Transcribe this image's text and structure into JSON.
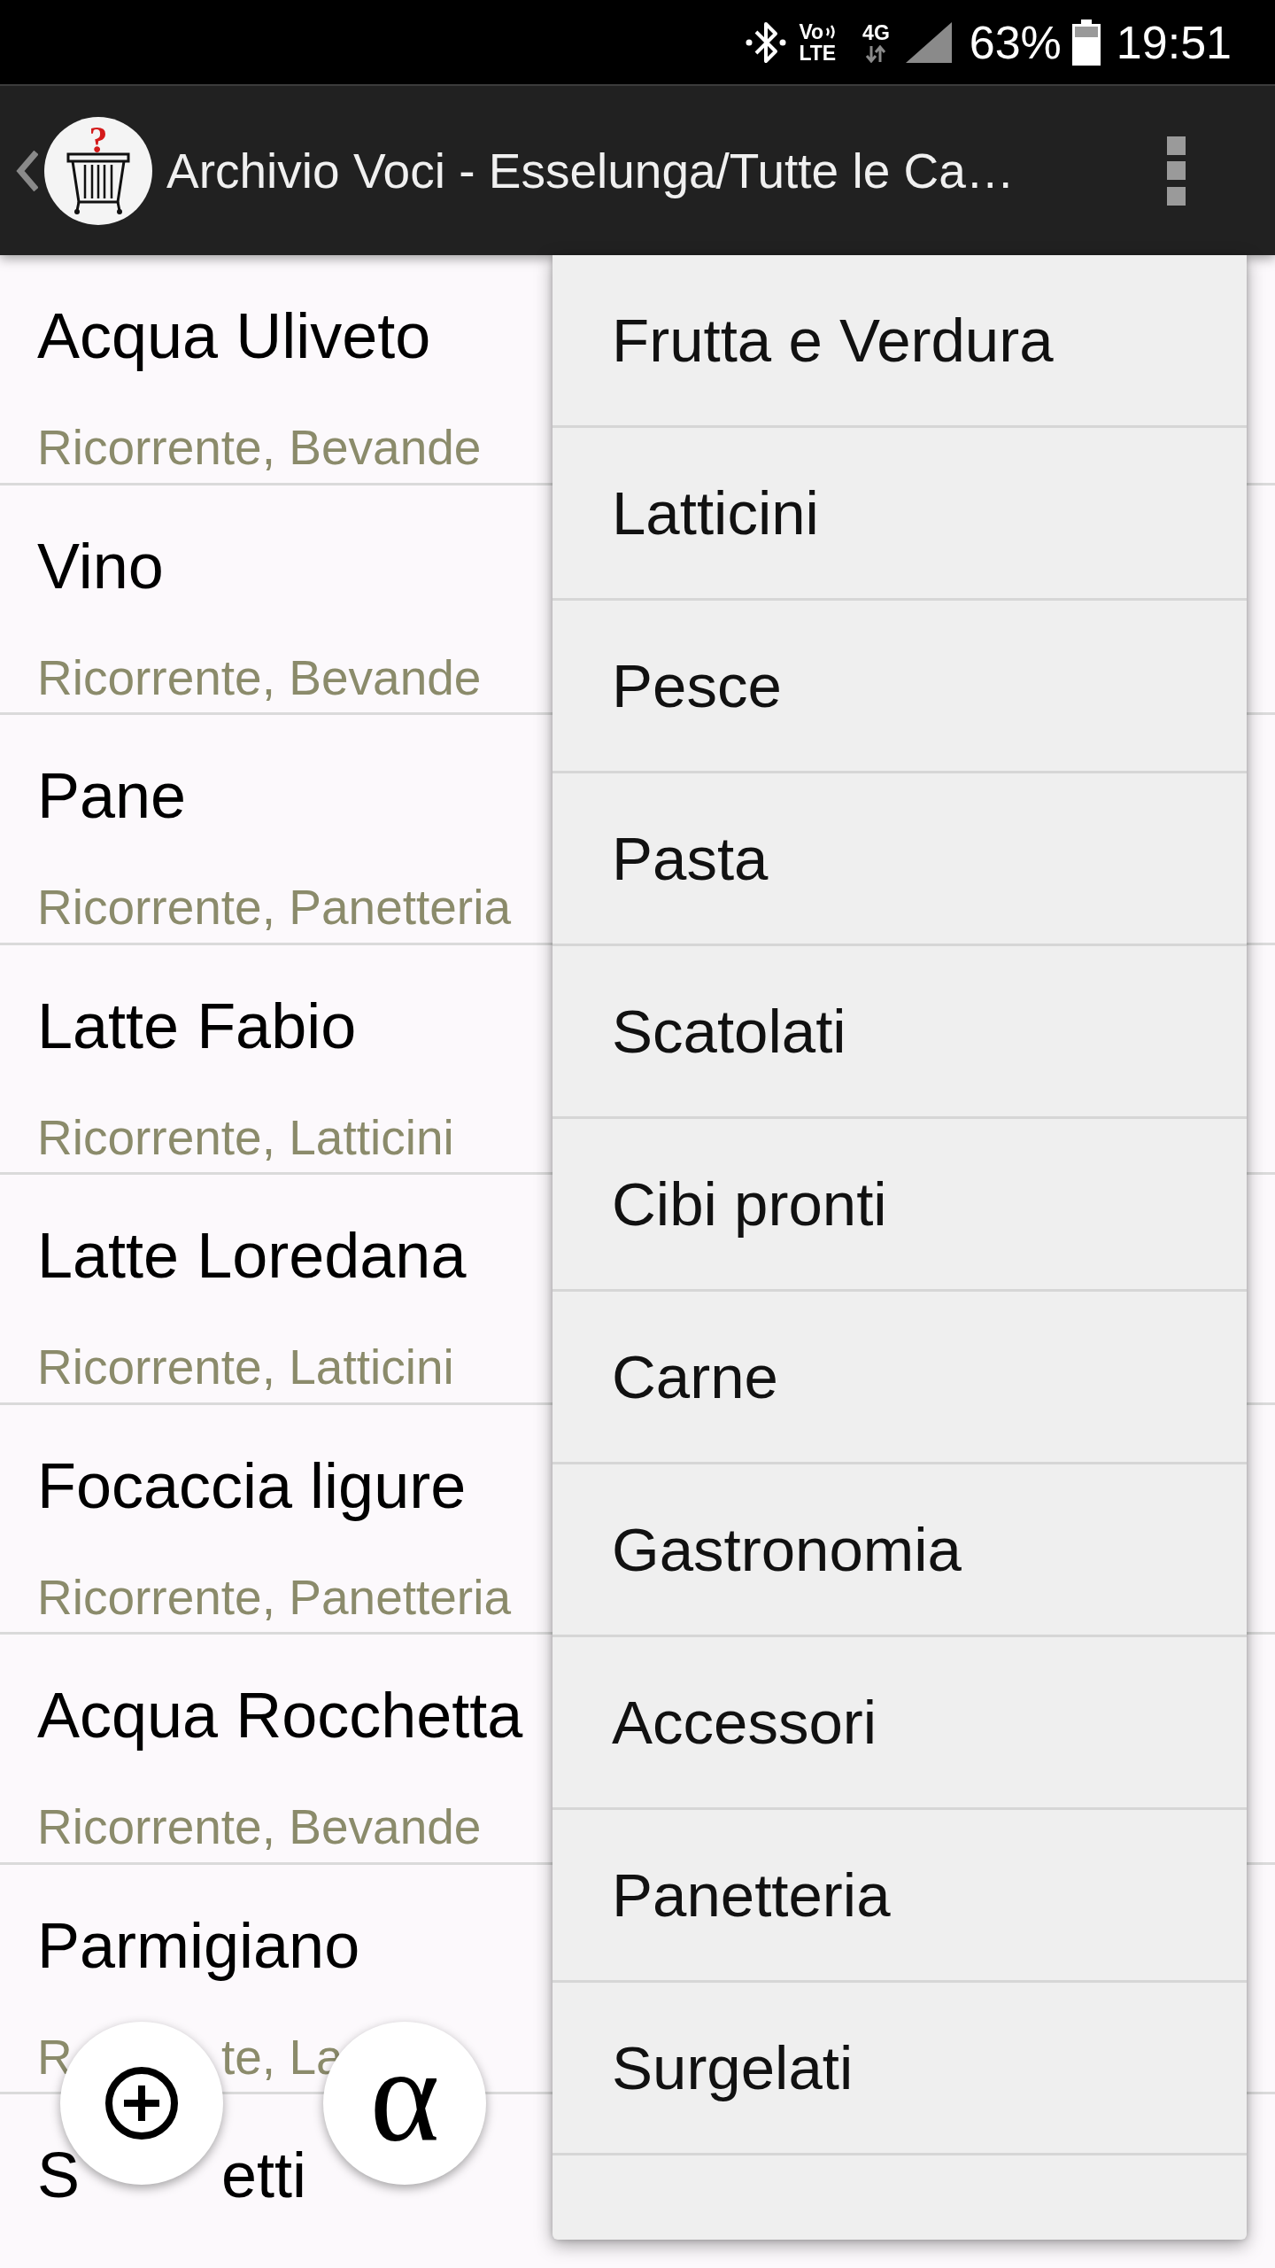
{
  "status_bar": {
    "volte": [
      "Vo",
      "LTE"
    ],
    "network": "4G",
    "battery": "63%",
    "time": "19:51"
  },
  "app_bar": {
    "logo_mark": "?",
    "title": "Archivio Voci - Esselunga/Tutte le Ca…"
  },
  "items": [
    {
      "name": "Acqua Uliveto",
      "details": "Ricorrente, Bevande"
    },
    {
      "name": "Vino",
      "details": "Ricorrente, Bevande"
    },
    {
      "name": "Pane",
      "details": "Ricorrente, Panetteria"
    },
    {
      "name": "Latte Fabio",
      "details": "Ricorrente, Latticini"
    },
    {
      "name": "Latte Loredana",
      "details": "Ricorrente, Latticini"
    },
    {
      "name": "Focaccia ligure",
      "details": "Ricorrente, Panetteria"
    },
    {
      "name": "Acqua Rocchetta",
      "details": "Ricorrente, Bevande"
    },
    {
      "name": "Parmigiano",
      "details": [
        "R",
        "te, La"
      ]
    },
    {
      "name": [
        "S",
        "etti"
      ]
    }
  ],
  "fabs": [
    {
      "kind": "add"
    },
    {
      "kind": "sort",
      "label": "α"
    }
  ],
  "category_menu": {
    "items": [
      "Frutta e Verdura",
      "Latticini",
      "Pesce",
      "Pasta",
      "Scatolati",
      "Cibi pronti",
      "Carne",
      "Gastronomia",
      "Accessori",
      "Panetteria",
      "Surgelati"
    ]
  }
}
